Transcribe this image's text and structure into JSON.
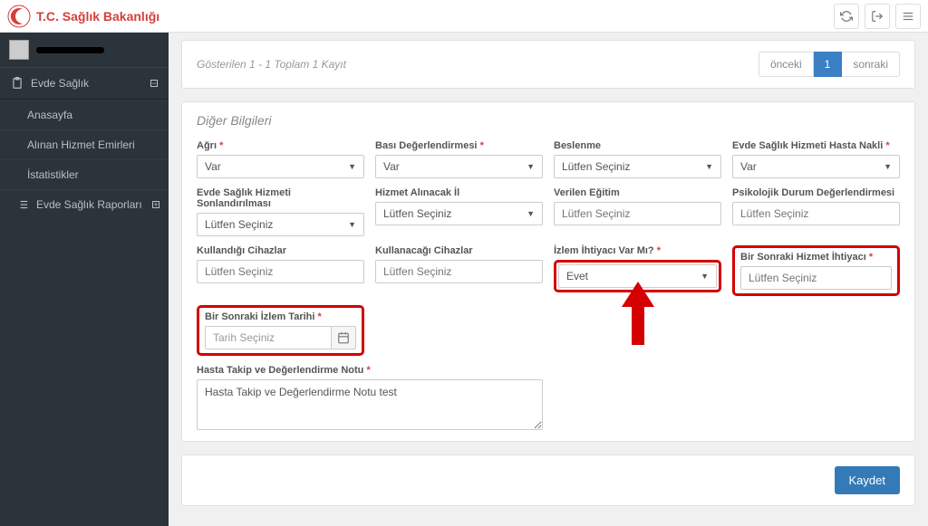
{
  "brand": "T.C. Sağlık Bakanlığı",
  "sidebar": {
    "section": "Evde Sağlık",
    "items": [
      {
        "label": "Anasayfa"
      },
      {
        "label": "Alınan Hizmet Emirleri"
      },
      {
        "label": "İstatistikler"
      },
      {
        "label": "Evde Sağlık Raporları"
      }
    ]
  },
  "topPanel": {
    "resultText": "Gösterilen 1 - 1 Toplam 1 Kayıt",
    "prev": "önceki",
    "page": "1",
    "next": "sonraki"
  },
  "form": {
    "title": "Diğer Bilgileri",
    "agri": {
      "label": "Ağrı",
      "value": "Var"
    },
    "basi": {
      "label": "Bası Değerlendirmesi",
      "value": "Var"
    },
    "beslenme": {
      "label": "Beslenme",
      "value": "Lütfen Seçiniz"
    },
    "nakli": {
      "label": "Evde Sağlık Hizmeti Hasta Nakli",
      "value": "Var"
    },
    "sonlandirma": {
      "label": "Evde Sağlık Hizmeti Sonlandırılması",
      "value": "Lütfen Seçiniz"
    },
    "alinacakIl": {
      "label": "Hizmet Alınacak İl",
      "value": "Lütfen Seçiniz"
    },
    "egitim": {
      "label": "Verilen Eğitim",
      "placeholder": "Lütfen Seçiniz"
    },
    "psiko": {
      "label": "Psikolojik Durum Değerlendirmesi",
      "placeholder": "Lütfen Seçiniz"
    },
    "kullandigi": {
      "label": "Kullandığı Cihazlar",
      "placeholder": "Lütfen Seçiniz"
    },
    "kullanacagi": {
      "label": "Kullanacağı Cihazlar",
      "placeholder": "Lütfen Seçiniz"
    },
    "izlem": {
      "label": "İzlem İhtiyacı Var Mı?",
      "value": "Evet"
    },
    "sonrakiHizmet": {
      "label": "Bir Sonraki Hizmet İhtiyacı",
      "placeholder": "Lütfen Seçiniz"
    },
    "sonrakiIzlem": {
      "label": "Bir Sonraki İzlem Tarihi",
      "placeholder": "Tarih Seçiniz"
    },
    "note": {
      "label": "Hasta Takip ve Değerlendirme Notu",
      "value": "Hasta Takip ve Değerlendirme Notu test"
    },
    "save": "Kaydet"
  }
}
